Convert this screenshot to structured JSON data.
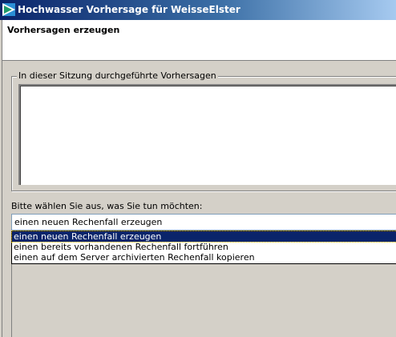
{
  "window": {
    "title": "Hochwasser Vorhersage für WeisseElster",
    "icon": "app-icon"
  },
  "header": {
    "title": "Vorhersagen erzeugen"
  },
  "session_group": {
    "legend": "In dieser Sitzung durchgeführte Vorhersagen",
    "items": []
  },
  "choice": {
    "label": "Bitte wählen Sie aus, was Sie tun möchten:",
    "selected_value": "einen neuen Rechenfall erzeugen",
    "options": [
      "einen neuen Rechenfall erzeugen",
      "einen bereits vorhandenen Rechenfall fortführen",
      "einen auf dem Server archivierten Rechenfall kopieren"
    ]
  },
  "colors": {
    "titlebar_start": "#0a246a",
    "titlebar_end": "#a6caf0",
    "selection": "#0a246a",
    "dialog_bg": "#d4d0c8"
  }
}
